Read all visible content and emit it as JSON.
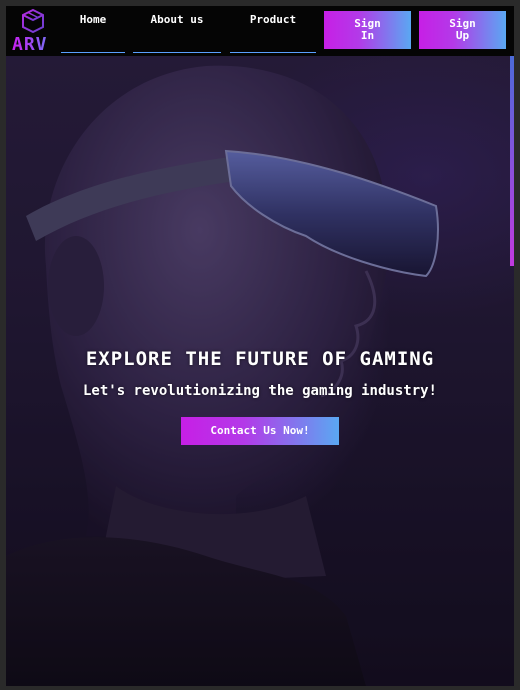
{
  "brand": {
    "name": "ARV",
    "logo_icon": "cube-icon",
    "gradient": [
      "#c81ff0",
      "#7a6df5"
    ]
  },
  "nav": {
    "items": [
      {
        "label": "Home"
      },
      {
        "label": "About us"
      },
      {
        "label": "Product"
      }
    ],
    "underline_color": "#5aa0ff"
  },
  "auth": {
    "signin_label": "Sign\nIn",
    "signup_label": "Sign\nUp",
    "button_gradient": [
      "#c71fe6",
      "#5aa8f2"
    ]
  },
  "hero": {
    "title": "EXPLORE THE FUTURE OF GAMING",
    "subtitle": "Let's revolutionizing the gaming industry!",
    "cta_label": "Contact Us Now!",
    "image_subject": "person-with-vr-glasses"
  },
  "colors": {
    "navbar_bg": "#050505",
    "hero_bg": "#231a36",
    "frame_bg": "#2a2a2a",
    "text": "#ffffff"
  }
}
